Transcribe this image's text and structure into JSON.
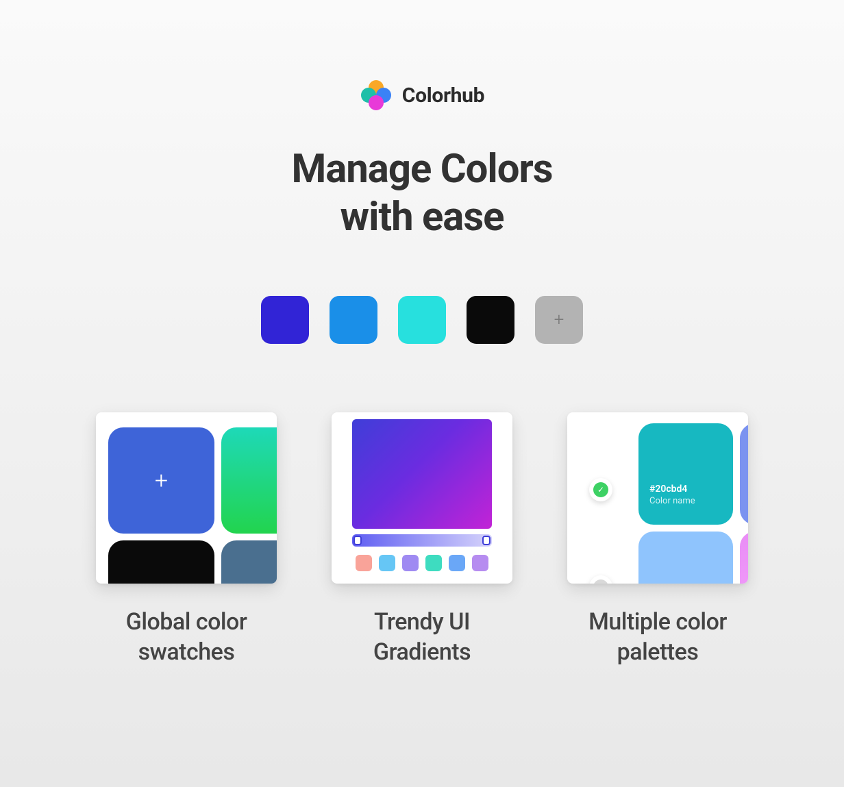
{
  "brand": {
    "name": "Colorhub"
  },
  "hero": {
    "title_line1": "Manage Colors",
    "title_line2": "with ease"
  },
  "swatches": [
    {
      "color": "#3124d6"
    },
    {
      "color": "#1a8fe8"
    },
    {
      "color": "#27e0de"
    },
    {
      "color": "#0a0a0a"
    }
  ],
  "swatch_add_label": "+",
  "features": [
    {
      "title_line1": "Global color",
      "title_line2": "swatches",
      "add_label": "+"
    },
    {
      "title_line1": "Trendy UI",
      "title_line2": "Gradients",
      "mini_colors": [
        "#f9a399",
        "#66c6f5",
        "#9f8af2",
        "#3edcc0",
        "#6aa7f7",
        "#b68cf0"
      ]
    },
    {
      "title_line1": "Multiple color",
      "title_line2": "palettes",
      "hex": "#20cbd4",
      "color_name": "Color name"
    }
  ]
}
